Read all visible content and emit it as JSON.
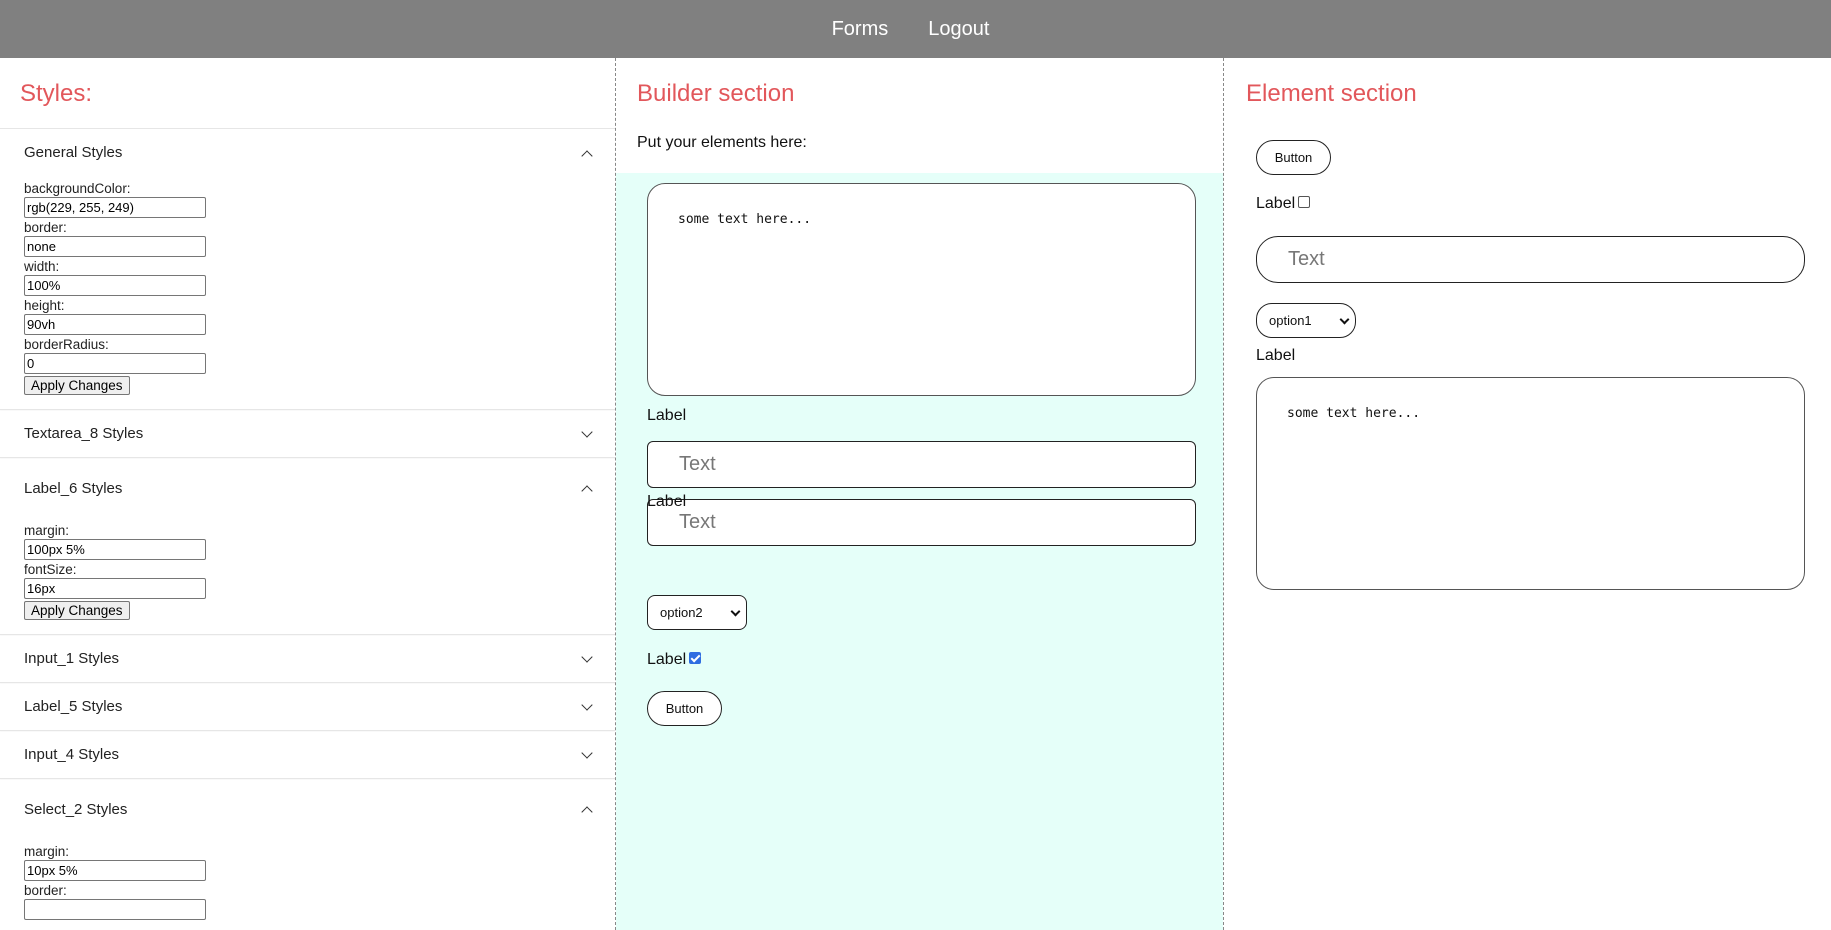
{
  "nav": {
    "forms": "Forms",
    "logout": "Logout"
  },
  "styles_panel": {
    "title": "Styles:",
    "general": {
      "header": "General Styles",
      "expanded": true,
      "fields": [
        {
          "label": "backgroundColor:",
          "value": "rgb(229, 255, 249)"
        },
        {
          "label": "border:",
          "value": "none"
        },
        {
          "label": "width:",
          "value": "100%"
        },
        {
          "label": "height:",
          "value": "90vh"
        },
        {
          "label": "borderRadius:",
          "value": "0"
        }
      ],
      "apply": "Apply Changes"
    },
    "textarea8": {
      "header": "Textarea_8 Styles",
      "expanded": false
    },
    "label6": {
      "header": "Label_6 Styles",
      "expanded": true,
      "fields": [
        {
          "label": "margin:",
          "value": "100px 5%"
        },
        {
          "label": "fontSize:",
          "value": "16px"
        }
      ],
      "apply": "Apply Changes"
    },
    "input1": {
      "header": "Input_1 Styles",
      "expanded": false
    },
    "label5": {
      "header": "Label_5 Styles",
      "expanded": false
    },
    "input4": {
      "header": "Input_4 Styles",
      "expanded": false
    },
    "select2": {
      "header": "Select_2 Styles",
      "expanded": true,
      "fields": [
        {
          "label": "margin:",
          "value": "10px 5%"
        },
        {
          "label": "border:",
          "value": ""
        }
      ]
    }
  },
  "builder": {
    "title": "Builder section",
    "instruction": "Put your elements here:",
    "textarea_value": "some text here...",
    "label_a": "Label",
    "input_a_placeholder": "Text",
    "label_b": "Label",
    "input_b_placeholder": "Text",
    "select_value": "option2",
    "checkbox_label": "Label",
    "checkbox_checked": true,
    "button_label": "Button",
    "canvas_color": "#e5fff9"
  },
  "element_section": {
    "title": "Element section",
    "button_label": "Button",
    "checkbox_label": "Label",
    "checkbox_checked": false,
    "input_placeholder": "Text",
    "select_value": "option1",
    "label": "Label",
    "textarea_value": "some text here..."
  },
  "colors": {
    "topbar": "#808080",
    "heading": "#e2575b",
    "checkbox_accent": "#2f6de1"
  }
}
